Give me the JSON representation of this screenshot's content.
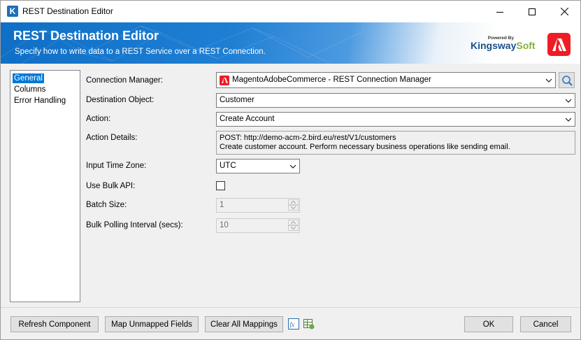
{
  "window": {
    "title": "REST Destination Editor",
    "app_icon_letter": "K"
  },
  "banner": {
    "title": "REST Destination Editor",
    "subtitle": "Specify how to write data to a REST Service over a REST Connection.",
    "logo_powered": "Powered By",
    "logo_brand": "Kingsway",
    "logo_brand_suffix": "Soft",
    "accent_color": "#1f7fd3",
    "adobe_color": "#ee1c25"
  },
  "nav": {
    "items": [
      {
        "label": "General",
        "selected": true
      },
      {
        "label": "Columns",
        "selected": false
      },
      {
        "label": "Error Handling",
        "selected": false
      }
    ]
  },
  "form": {
    "connection_manager": {
      "label": "Connection Manager:",
      "value": "MagentoAdobeCommerce - REST Connection Manager"
    },
    "destination_object": {
      "label": "Destination Object:",
      "value": "Customer"
    },
    "action": {
      "label": "Action:",
      "value": "Create Account"
    },
    "action_details": {
      "label": "Action Details:",
      "line1": "POST: http://demo-acm-2.bird.eu/rest/V1/customers",
      "line2": "Create customer account. Perform necessary business operations like sending email."
    },
    "input_time_zone": {
      "label": "Input Time Zone:",
      "value": "UTC"
    },
    "use_bulk_api": {
      "label": "Use Bulk API:",
      "checked": false
    },
    "batch_size": {
      "label": "Batch Size:",
      "value": "1"
    },
    "bulk_polling_interval": {
      "label": "Bulk Polling Interval (secs):",
      "value": "10"
    }
  },
  "footer": {
    "refresh_label": "Refresh Component",
    "map_unmapped_label": "Map Unmapped Fields",
    "clear_mappings_label": "Clear All Mappings",
    "ok_label": "OK",
    "cancel_label": "Cancel"
  }
}
